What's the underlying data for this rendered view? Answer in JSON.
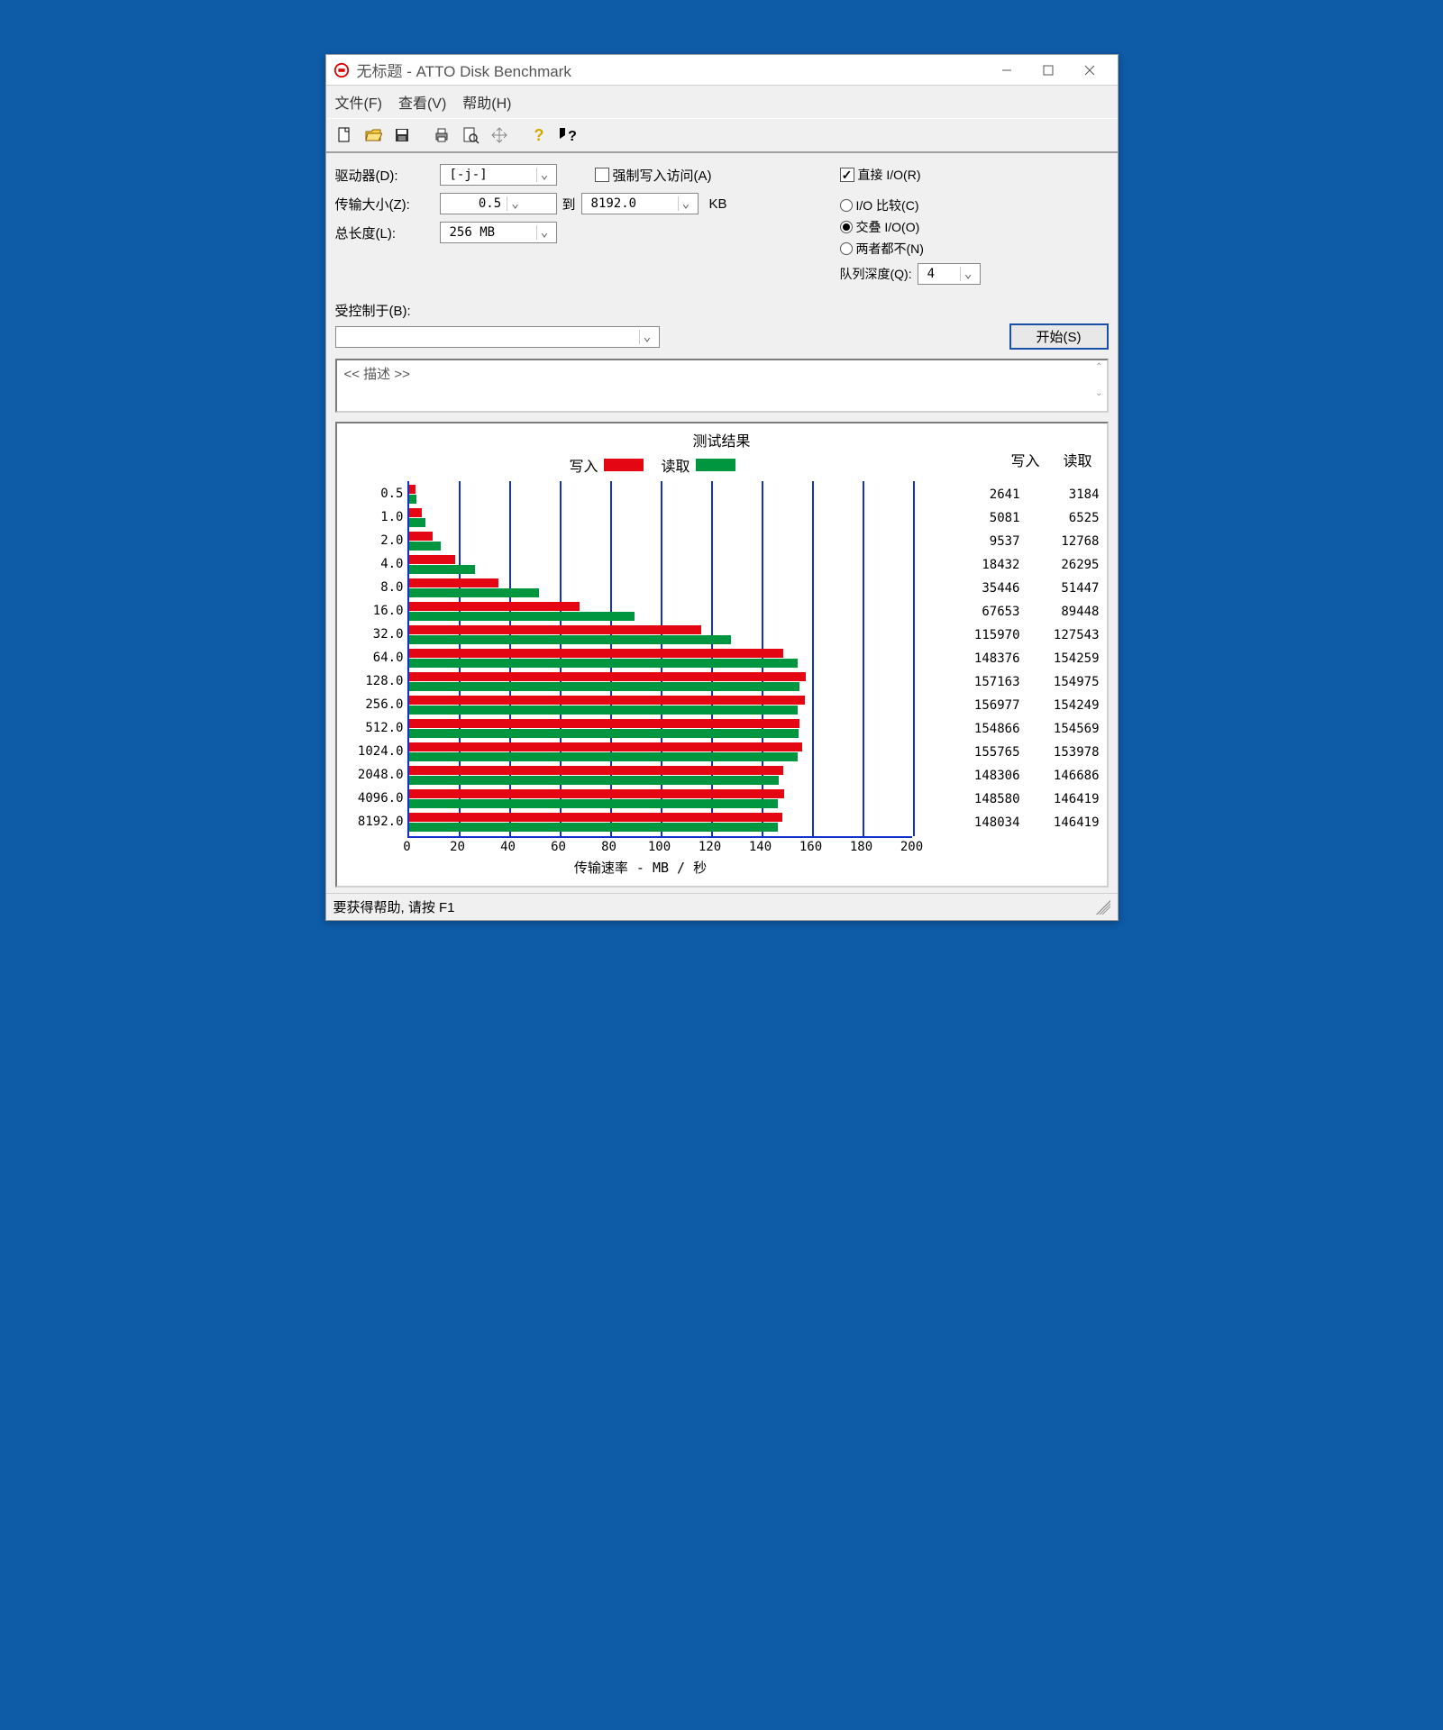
{
  "window": {
    "title": "无标题 - ATTO Disk Benchmark"
  },
  "menubar": {
    "file": "文件(F)",
    "view": "查看(V)",
    "help": "帮助(H)"
  },
  "config": {
    "drive_label": "驱动器(D):",
    "drive_value": "[-j-]",
    "transfer_size_label": "传输大小(Z):",
    "transfer_min": "0.5",
    "transfer_to": "到",
    "transfer_max": "8192.0",
    "transfer_unit": "KB",
    "total_length_label": "总长度(L):",
    "total_length_value": "256 MB",
    "force_write_label": "强制写入访问(A)",
    "force_write_checked": false,
    "direct_io_label": "直接 I/O(R)",
    "direct_io_checked": true,
    "io_compare_label": "I/O 比较(C)",
    "overlap_io_label": "交叠 I/O(O)",
    "neither_label": "两者都不(N)",
    "io_mode_selected": "overlap",
    "queue_depth_label": "队列深度(Q):",
    "queue_depth_value": "4",
    "controlled_by_label": "受控制于(B):",
    "controlled_by_value": "",
    "start_button": "开始(S)",
    "description_placeholder": "<< 描述 >>"
  },
  "results": {
    "title": "测试结果",
    "write_legend": "写入",
    "read_legend": "读取",
    "col_write": "写入",
    "col_read": "读取",
    "xaxis_label": "传输速率 - MB / 秒"
  },
  "chart_data": {
    "type": "bar",
    "x_max": 200,
    "x_ticks": [
      0,
      20,
      40,
      60,
      80,
      100,
      120,
      140,
      160,
      180,
      200
    ],
    "categories": [
      "0.5",
      "1.0",
      "2.0",
      "4.0",
      "8.0",
      "16.0",
      "32.0",
      "64.0",
      "128.0",
      "256.0",
      "512.0",
      "1024.0",
      "2048.0",
      "4096.0",
      "8192.0"
    ],
    "series": [
      {
        "name": "写入",
        "color": "#e40613",
        "values": [
          2641,
          5081,
          9537,
          18432,
          35446,
          67653,
          115970,
          148376,
          157163,
          156977,
          154866,
          155765,
          148306,
          148580,
          148034
        ]
      },
      {
        "name": "读取",
        "color": "#009640",
        "values": [
          3184,
          6525,
          12768,
          26295,
          51447,
          89448,
          127543,
          154259,
          154975,
          154249,
          154569,
          153978,
          146686,
          146419,
          146419
        ]
      }
    ],
    "title": "测试结果",
    "xlabel": "传输速率 - MB / 秒",
    "ylabel": "",
    "xlim": [
      0,
      200
    ]
  },
  "statusbar": {
    "text": "要获得帮助, 请按 F1"
  }
}
